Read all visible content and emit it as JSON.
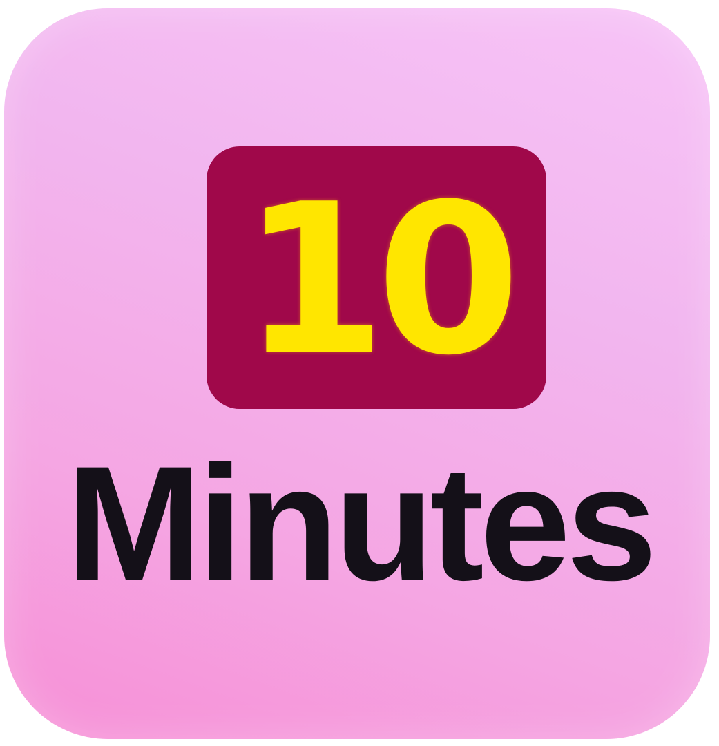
{
  "icon": {
    "number": "10",
    "label": "Minutes"
  },
  "colors": {
    "tile_background": "#f2b6ef",
    "badge_background": "#a0084a",
    "number_color": "#ffe600",
    "label_color": "#141018"
  }
}
